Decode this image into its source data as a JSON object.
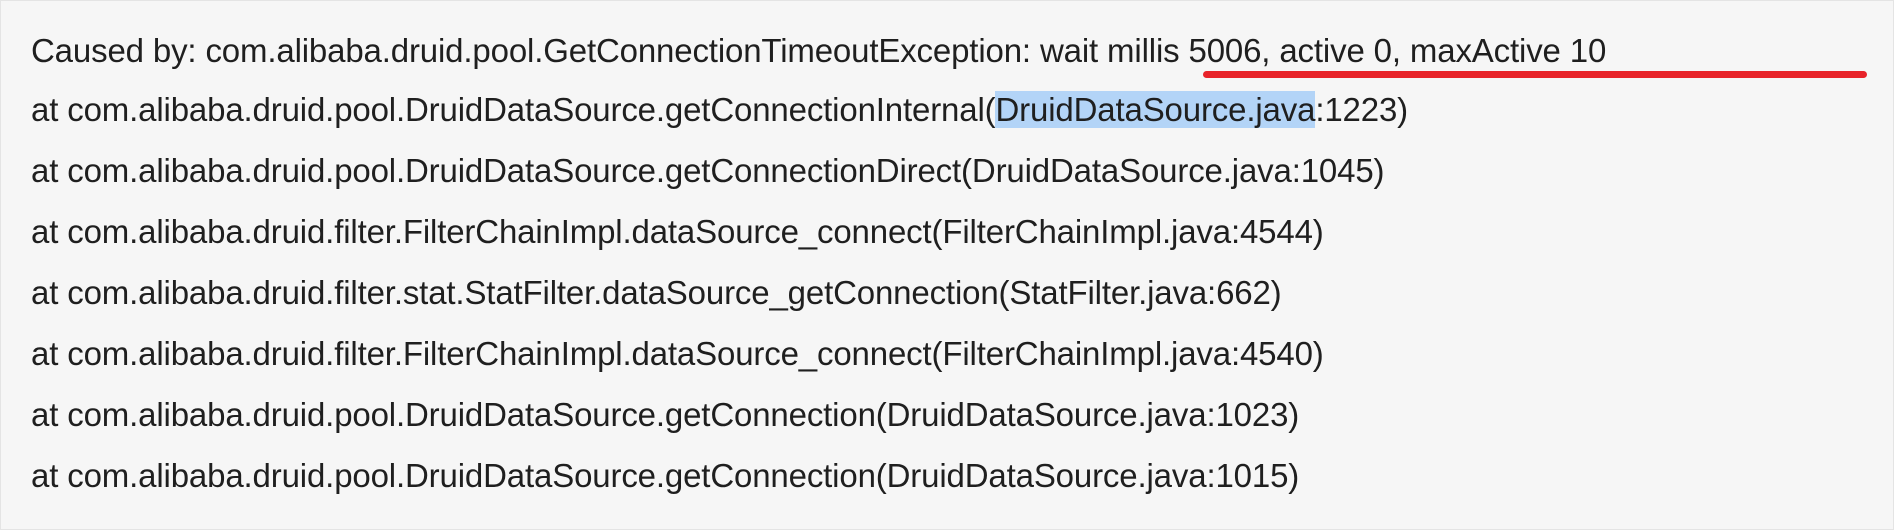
{
  "stack_trace": {
    "cause_prefix": "Caused by: com.alibaba.druid.pool.GetConnectionTimeoutException: ",
    "cause_detail": "wait millis 5006, active 0, maxActive 10",
    "frame1_prefix": "at com.alibaba.druid.pool.DruidDataSource.getConnectionInternal(",
    "frame1_selected": "DruidDataSource.java",
    "frame1_suffix": ":1223)",
    "frame2": "at com.alibaba.druid.pool.DruidDataSource.getConnectionDirect(DruidDataSource.java:1045)",
    "frame3": "at com.alibaba.druid.filter.FilterChainImpl.dataSource_connect(FilterChainImpl.java:4544)",
    "frame4": "at com.alibaba.druid.filter.stat.StatFilter.dataSource_getConnection(StatFilter.java:662)",
    "frame5": "at com.alibaba.druid.filter.FilterChainImpl.dataSource_connect(FilterChainImpl.java:4540)",
    "frame6": "at com.alibaba.druid.pool.DruidDataSource.getConnection(DruidDataSource.java:1023)",
    "frame7": "at com.alibaba.druid.pool.DruidDataSource.getConnection(DruidDataSource.java:1015)"
  },
  "colors": {
    "text": "#1f1f1f",
    "selection": "#b3d4f7",
    "annotation_underline": "#e8232a",
    "background": "#f6f6f6"
  }
}
